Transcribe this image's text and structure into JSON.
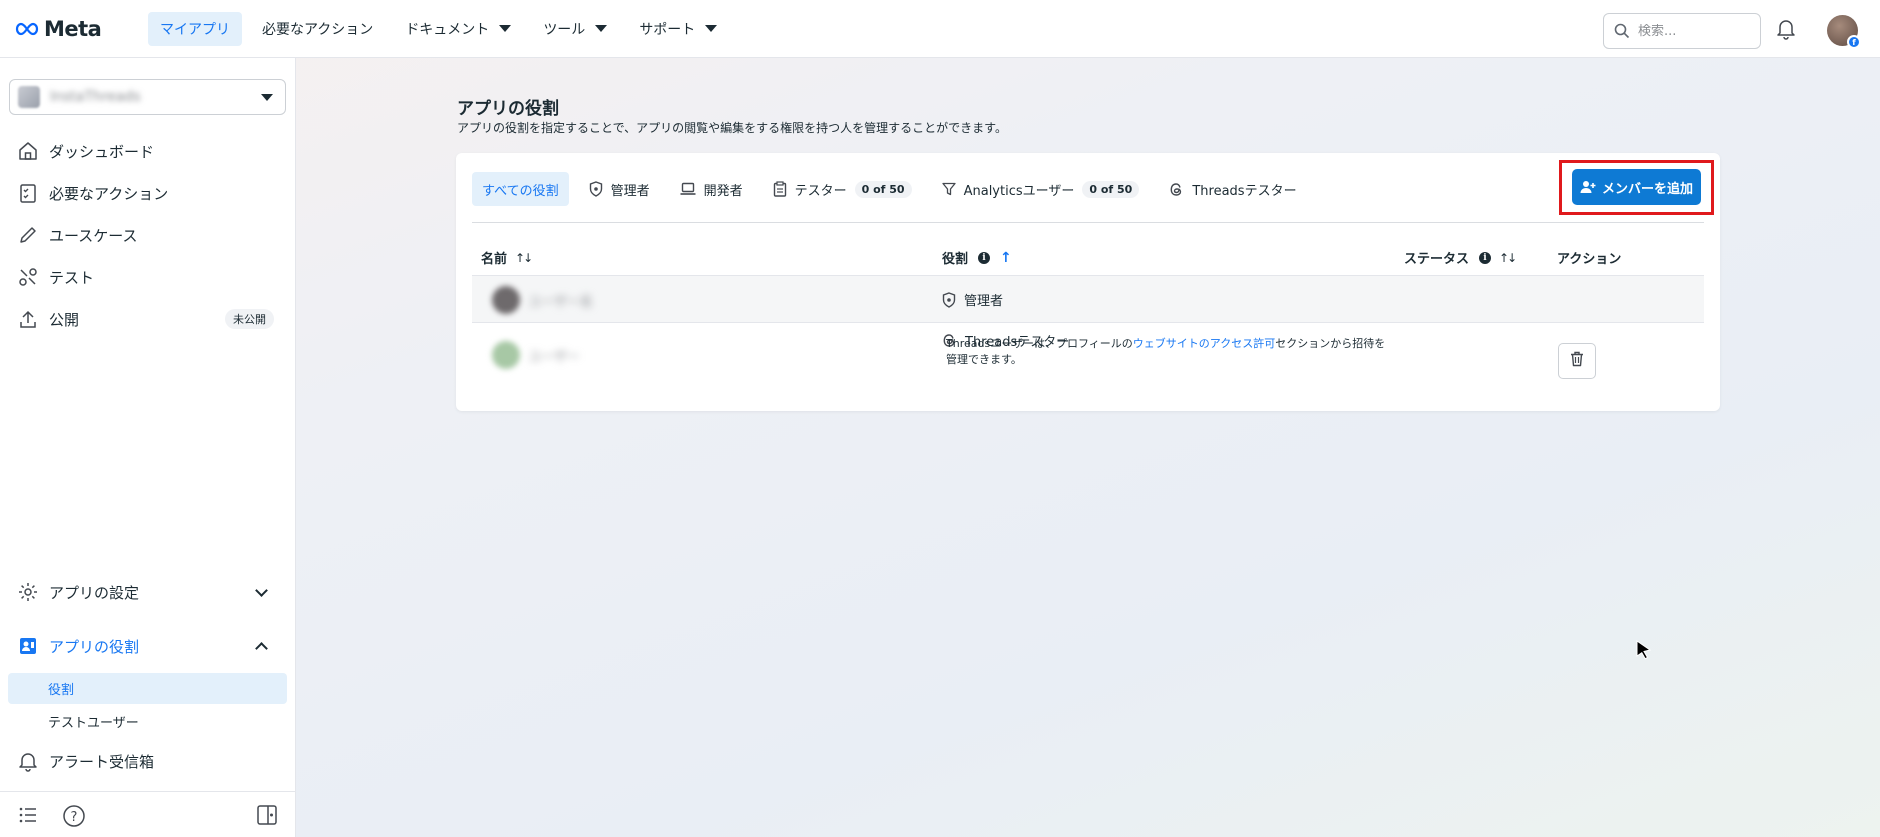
{
  "topbar": {
    "logo_text": "Meta",
    "nav": [
      {
        "label": "マイアプリ"
      },
      {
        "label": "必要なアクション"
      },
      {
        "label": "ドキュメント"
      },
      {
        "label": "ツール"
      },
      {
        "label": "サポート"
      }
    ],
    "search_placeholder": "検索..."
  },
  "sidebar": {
    "app_name": "InstaThreads",
    "items": [
      {
        "label": "ダッシュボード",
        "icon": "home-icon"
      },
      {
        "label": "必要なアクション",
        "icon": "checklist-icon"
      },
      {
        "label": "ユースケース",
        "icon": "pencil-icon"
      },
      {
        "label": "テスト",
        "icon": "tools-icon"
      },
      {
        "label": "公開",
        "icon": "upload-icon",
        "badge": "未公開"
      }
    ],
    "settings_label": "アプリの設定",
    "roles_label": "アプリの役割",
    "sub_items": [
      {
        "label": "役割"
      },
      {
        "label": "テストユーザー"
      }
    ],
    "alerts_label": "アラート受信箱"
  },
  "main": {
    "title": "アプリの役割",
    "description": "アプリの役割を指定することで、アプリの閲覧や編集をする権限を持つ人を管理することができます。",
    "tabs": [
      {
        "label": "すべての役割"
      },
      {
        "label": "管理者"
      },
      {
        "label": "開発者"
      },
      {
        "label": "テスター",
        "count": "0 of 50"
      },
      {
        "label": "Analyticsユーザー",
        "count": "0 of 50"
      },
      {
        "label": "Threadsテスター"
      }
    ],
    "add_member_label": "メンバーを追加",
    "columns": {
      "name": "名前",
      "role": "役割",
      "status": "ステータス",
      "action": "アクション"
    },
    "rows": [
      {
        "name": "ユーザー名",
        "role": "管理者"
      },
      {
        "name": "ユーザー",
        "role": "Threadsテスター",
        "desc_before": "Threadsユーザーは、プロフィールの",
        "desc_link": "ウェブサイトのアクセス許可",
        "desc_after": "セクションから招待を管理できます。"
      }
    ]
  },
  "colors": {
    "accent": "#1877f2",
    "button": "#0e7ad4",
    "highlight_outline": "#e0191c"
  }
}
